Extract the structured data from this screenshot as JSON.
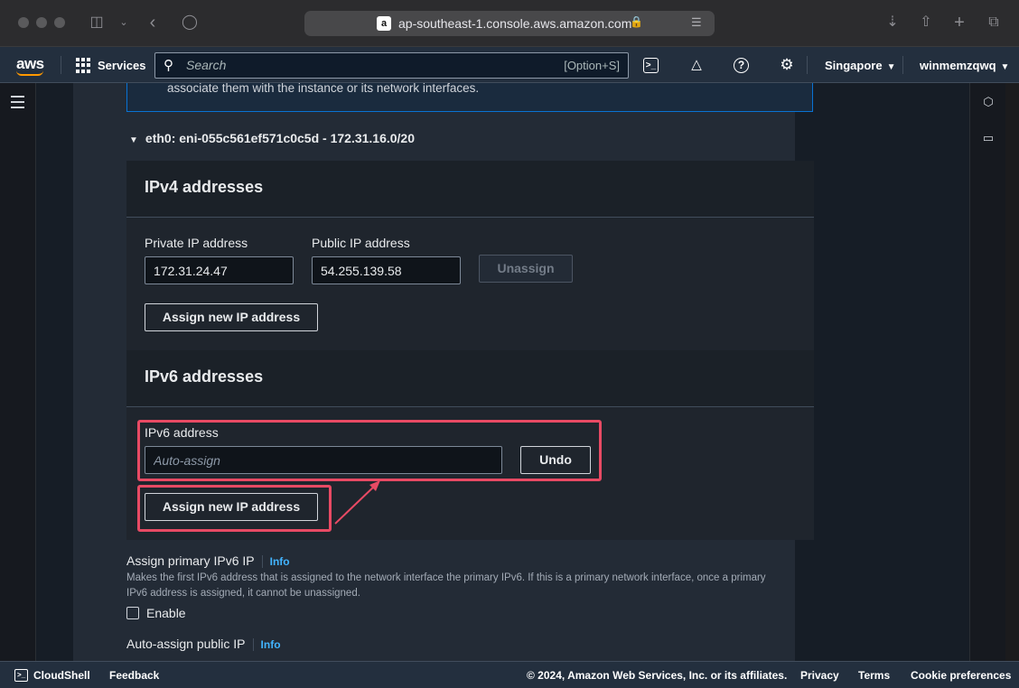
{
  "browser": {
    "url": "ap-southeast-1.console.aws.amazon.com",
    "favicon_letter": "a"
  },
  "nav": {
    "logo": "aws",
    "services_label": "Services",
    "search_placeholder": "Search",
    "search_shortcut": "[Option+S]",
    "region": "Singapore",
    "account": "winmemzqwq"
  },
  "alert": {
    "text": "associate them with the instance or its network interfaces."
  },
  "eni": {
    "header": "eth0: eni-055c561ef571c0c5d - 172.31.16.0/20"
  },
  "ipv4": {
    "title": "IPv4 addresses",
    "private_label": "Private IP address",
    "private_value": "172.31.24.47",
    "public_label": "Public IP address",
    "public_value": "54.255.139.58",
    "unassign_label": "Unassign",
    "assign_label": "Assign new IP address"
  },
  "ipv6": {
    "title": "IPv6 addresses",
    "address_label": "IPv6 address",
    "address_placeholder": "Auto-assign",
    "undo_label": "Undo",
    "assign_label": "Assign new IP address"
  },
  "primary_ipv6": {
    "label": "Assign primary IPv6 IP",
    "info": "Info",
    "description_line1": "Makes the first IPv6 address that is assigned to the network interface the primary IPv6. If this is a primary network interface, once a primary",
    "description_line2": "IPv6 address is assigned, it cannot be unassigned.",
    "checkbox_label": "Enable",
    "checked": false
  },
  "auto_public_ip": {
    "label": "Auto-assign public IP",
    "info": "Info"
  },
  "footer": {
    "cloudshell": "CloudShell",
    "feedback": "Feedback",
    "copyright": "© 2024, Amazon Web Services, Inc. or its affiliates.",
    "privacy": "Privacy",
    "terms": "Terms",
    "cookies": "Cookie preferences"
  },
  "colors": {
    "highlight": "#e84a64",
    "link": "#42b4ff",
    "nav_bg": "#232f3e"
  }
}
